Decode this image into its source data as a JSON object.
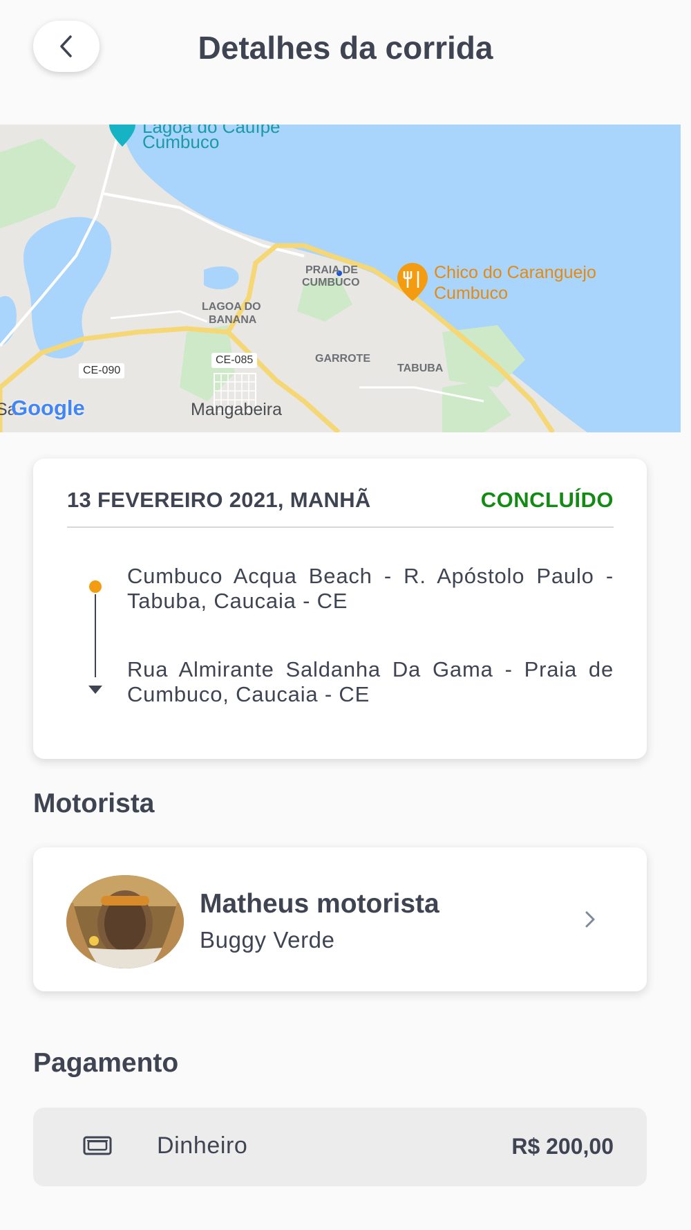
{
  "header": {
    "title": "Detalhes da corrida",
    "back_icon": "chevron-left-icon"
  },
  "map": {
    "labels": {
      "lagoa": "Lagoa do Cauípe",
      "cumbuco": "Cumbuco",
      "praia_de": "PRAIA DE",
      "praia_cumbuco": "CUMBUCO",
      "restaurant_line1": "Chico do Caranguejo",
      "restaurant_line2": "Cumbuco",
      "lagoa_banana_1": "LAGOA DO",
      "lagoa_banana_2": "BANANA",
      "ce085": "CE-085",
      "ce090": "CE-090",
      "garrote": "GARROTE",
      "tabuba": "TABUBA",
      "mangabeira": "Mangabeira",
      "google": "Google",
      "sa": "Sa"
    },
    "colors": {
      "water": "#a9d4fb",
      "land": "#e9e7e3",
      "road": "#f6d775",
      "park": "#cde9c8",
      "marker": "#f39c12"
    }
  },
  "ride": {
    "date": "13 FEVEREIRO 2021, MANHÃ",
    "status": "CONCLUÍDO",
    "status_color": "#138a13",
    "origin": "Cumbuco Acqua Beach - R. Apóstolo Paulo - Tabuba, Caucaia - CE",
    "destination": "Rua Almirante Saldanha Da Gama - Praia de Cumbuco, Caucaia - CE"
  },
  "driver_section": {
    "title": "Motorista",
    "name": "Matheus motorista",
    "vehicle": "Buggy Verde",
    "chevron_icon": "chevron-right-icon"
  },
  "payment_section": {
    "title": "Pagamento",
    "method": "Dinheiro",
    "amount": "R$ 200,00",
    "icon": "cash-icon"
  }
}
